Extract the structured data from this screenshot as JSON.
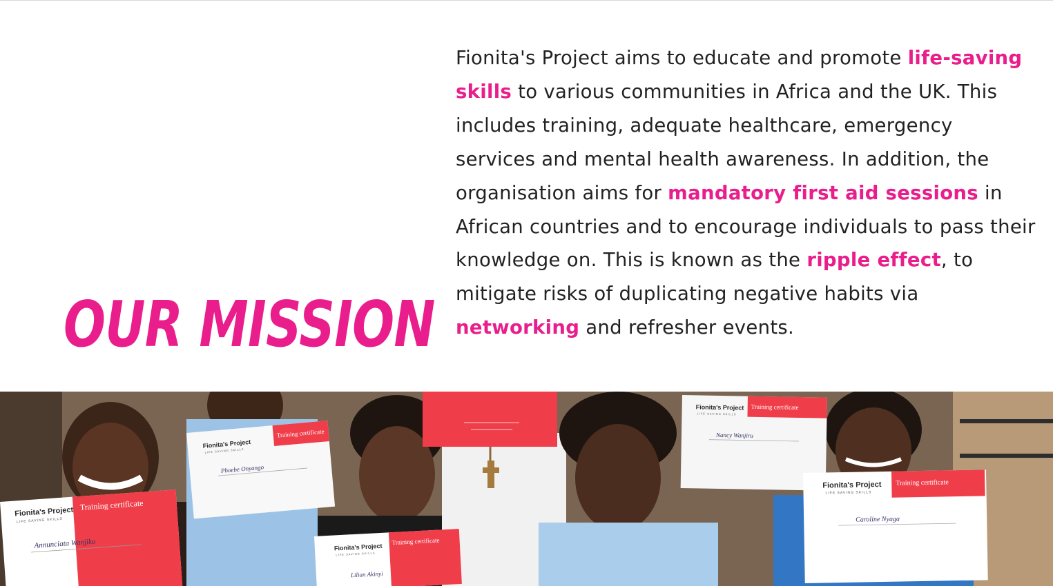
{
  "heading": "OUR MISSION",
  "paragraph": [
    {
      "text": "Fionita's Project aims to educate and promote ",
      "highlight": false
    },
    {
      "text": "life-saving skills",
      "highlight": true
    },
    {
      "text": " to various communities in Africa and the UK.  This includes training, adequate healthcare, emergency services and mental health awareness. In addition, the organisation aims for ",
      "highlight": false
    },
    {
      "text": "mandatory first aid sessions",
      "highlight": true
    },
    {
      "text": " in African countries and to encourage individuals to pass their knowledge on. This is known as the ",
      "highlight": false
    },
    {
      "text": "ripple effect",
      "highlight": true
    },
    {
      "text": ", to mitigate risks of duplicating negative habits via ",
      "highlight": false
    },
    {
      "text": "networking",
      "highlight": true
    },
    {
      "text": " and refresher events.",
      "highlight": false
    }
  ],
  "photo": {
    "certificates": [
      {
        "org": "Fionita's Project",
        "tagline": "LIFE SAVING SKILLS",
        "label": "Training certificate",
        "name": "Annunciata Wanjiku"
      },
      {
        "org": "Fionita's Project",
        "tagline": "LIFE SAVING SKILLS",
        "label": "Training certificate",
        "name": "Phoebe Onyango"
      },
      {
        "org": "Fionita's Project",
        "tagline": "LIFE SAVING SKILLS",
        "label": "Training certificate",
        "name": "Lilian Akinyi"
      },
      {
        "org": "Fionita's Project",
        "tagline": "LIFE SAVING SKILLS",
        "label": "Training certificate",
        "name": "Nancy Wanjiru"
      },
      {
        "org": "Fionita's Project",
        "tagline": "LIFE SAVING SKILLS",
        "label": "Training certificate",
        "name": "Caroline Nyaga"
      }
    ]
  },
  "colors": {
    "accent": "#e91e8c",
    "text": "#222222",
    "background": "#ffffff"
  }
}
